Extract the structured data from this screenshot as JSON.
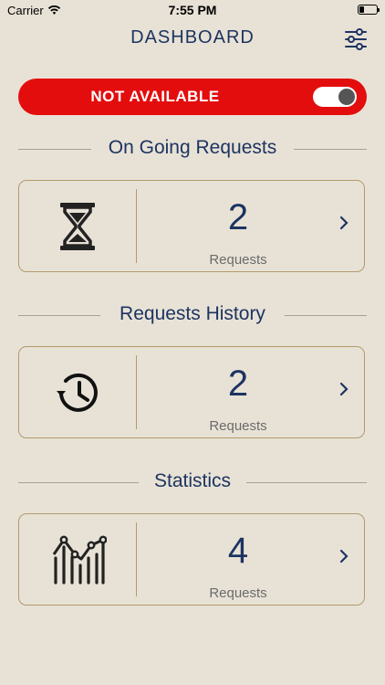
{
  "status": {
    "carrier": "Carrier",
    "time": "7:55 PM"
  },
  "nav": {
    "title": "DASHBOARD"
  },
  "availability": {
    "label": "NOT AVAILABLE",
    "toggle_on": true,
    "color": "#e40d0d"
  },
  "sections": [
    {
      "title": "On Going Requests",
      "count": "2",
      "unit": "Requests",
      "icon": "hourglass-icon"
    },
    {
      "title": "Requests History",
      "count": "2",
      "unit": "Requests",
      "icon": "history-clock-icon"
    },
    {
      "title": "Statistics",
      "count": "4",
      "unit": "Requests",
      "icon": "statistics-chart-icon"
    }
  ],
  "colors": {
    "background": "#e8e2d6",
    "accent": "#1d3461",
    "border": "#b39a6a"
  }
}
